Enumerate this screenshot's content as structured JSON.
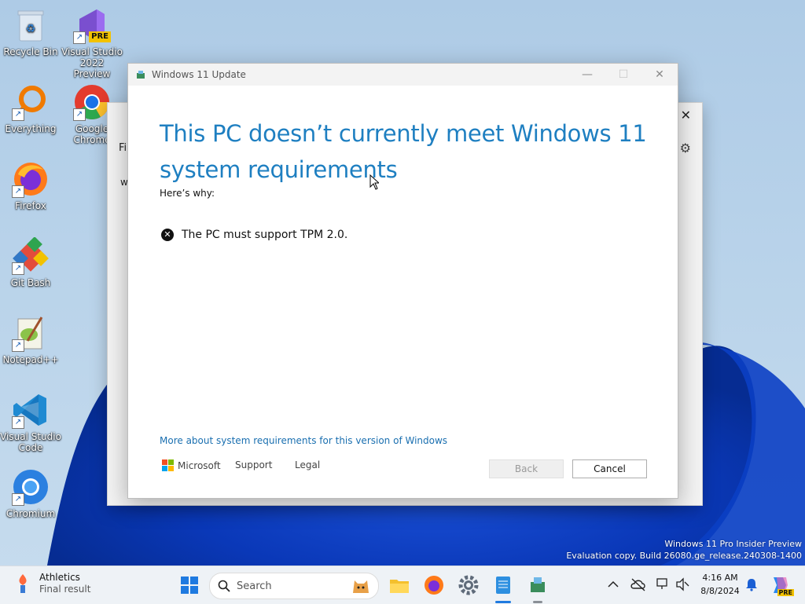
{
  "desktop": {
    "icons": [
      {
        "label": "Recycle Bin"
      },
      {
        "label": "Visual Studio 2022 Preview",
        "badge": "PRE"
      },
      {
        "label": "Everything"
      },
      {
        "label": "Google Chrome"
      },
      {
        "label": "Firefox"
      },
      {
        "label": "Git Bash"
      },
      {
        "label": "Notepad++"
      },
      {
        "label": "Visual Studio Code"
      },
      {
        "label": "Chromium"
      }
    ],
    "shortcut_glyph": "↗"
  },
  "background_window": {
    "close_glyph": "✕",
    "gear_glyph": "⚙",
    "fragment_fi": "Fi",
    "fragment_w": "w"
  },
  "dialog": {
    "title": "Windows 11 Update",
    "minimize_glyph": "—",
    "maximize_glyph": "☐",
    "close_glyph": "✕",
    "heading": "This PC doesn’t currently meet Windows 11 system requirements",
    "subheading": "Here’s why:",
    "requirement": "The PC must support TPM 2.0.",
    "requirement_icon_glyph": "✕",
    "more_link": "More about system requirements for this version of Windows",
    "brand": "Microsoft",
    "support_link": "Support",
    "legal_link": "Legal",
    "back_button": "Back",
    "cancel_button": "Cancel"
  },
  "taskbar": {
    "widget_title": "Athletics",
    "widget_subtitle": "Final result",
    "search_placeholder": "Search",
    "time": "4:16 AM",
    "date": "8/8/2024",
    "copilot_badge": "PRE"
  },
  "watermark": {
    "line1": "Windows 11 Pro Insider Preview",
    "line2": "Evaluation copy. Build 26080.ge_release.240308-1400"
  },
  "colors": {
    "accent_blue": "#1e7fc1",
    "link_blue": "#1a6fb0",
    "ms_red": "#f25022",
    "ms_green": "#7fba00",
    "ms_blue": "#00a4ef",
    "ms_yellow": "#ffb900"
  }
}
